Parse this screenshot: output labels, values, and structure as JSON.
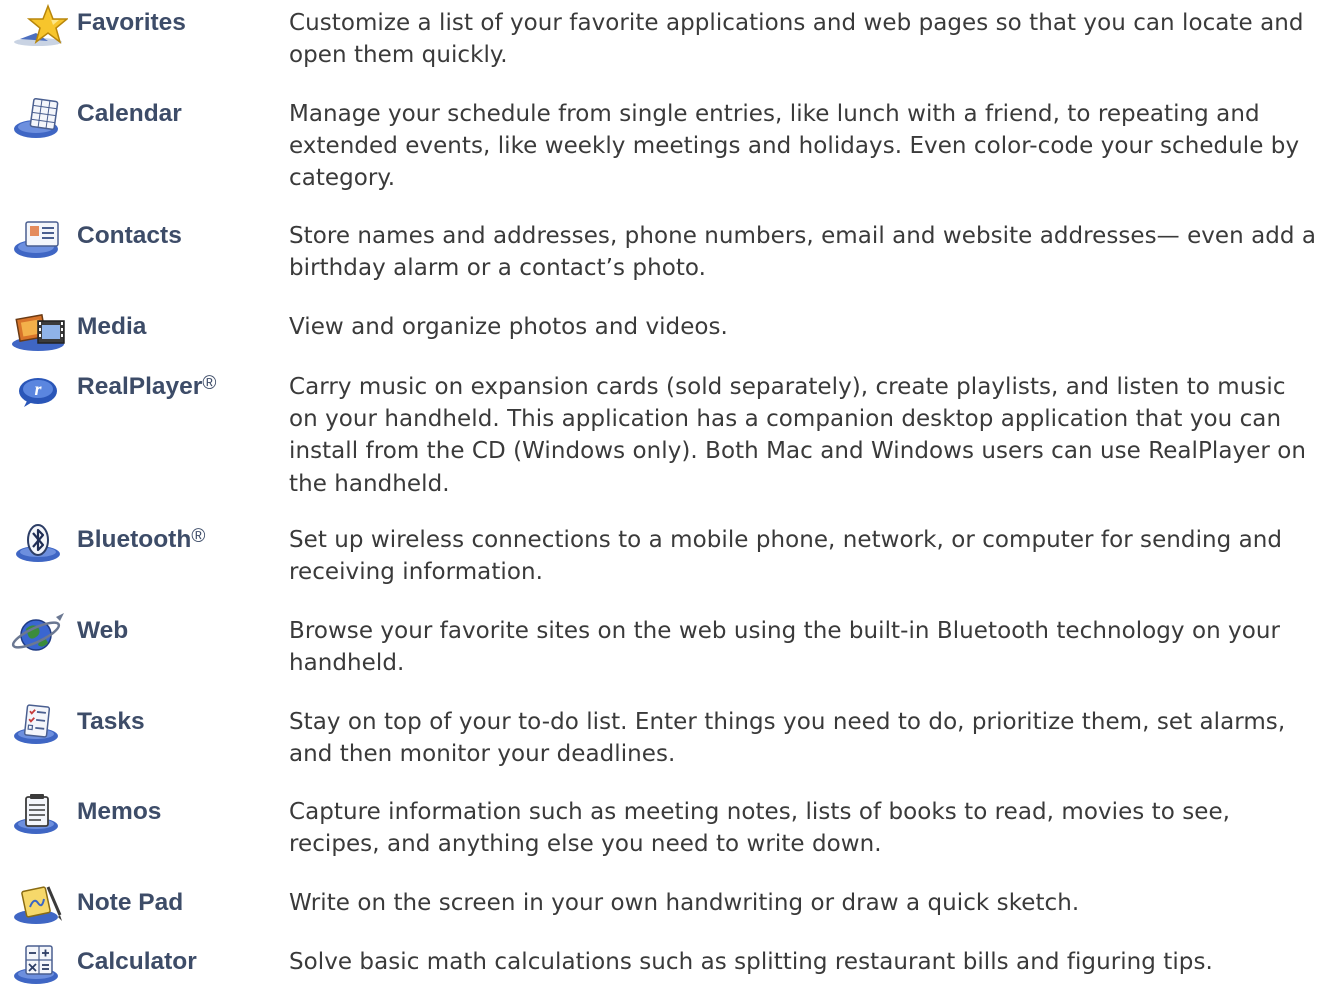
{
  "apps": [
    {
      "icon": "star-icon",
      "name": "Favorites",
      "reg": "",
      "desc": "Customize a list of your favorite applications and web pages so that you can locate and open them quickly."
    },
    {
      "icon": "calendar-icon",
      "name": "Calendar",
      "reg": "",
      "desc": "Manage your schedule from single entries, like lunch with a friend, to repeating and extended events, like weekly meetings and holidays. Even color-code your schedule by category."
    },
    {
      "icon": "contacts-icon",
      "name": "Contacts",
      "reg": "",
      "desc": "Store names and addresses, phone numbers, email and website addresses— even add a birthday alarm or a contact’s photo."
    },
    {
      "icon": "media-icon",
      "name": "Media",
      "reg": "",
      "desc": "View and organize photos and videos."
    },
    {
      "icon": "realplayer-icon",
      "name": "RealPlayer",
      "reg": "®",
      "desc": "Carry music on expansion cards (sold separately), create playlists, and listen to music on your handheld. This application has a companion desktop application that you can install from the CD (Windows only). Both Mac and Windows users can use RealPlayer on the handheld."
    },
    {
      "icon": "bluetooth-icon",
      "name": "Bluetooth",
      "reg": "®",
      "desc": "Set up wireless connections to a mobile phone, network, or computer for sending and receiving information."
    },
    {
      "icon": "web-globe-icon",
      "name": "Web",
      "reg": "",
      "desc": "Browse your favorite sites on the web using the built-in Bluetooth technology on your handheld."
    },
    {
      "icon": "tasks-checklist-icon",
      "name": "Tasks",
      "reg": "",
      "desc": "Stay on top of your to-do list. Enter things you need to do, prioritize them, set alarms, and then monitor your deadlines."
    },
    {
      "icon": "memos-notepad-icon",
      "name": "Memos",
      "reg": "",
      "desc": "Capture information such as meeting notes, lists of books to read, movies to see, recipes, and anything else you need to write down."
    },
    {
      "icon": "note-pad-icon",
      "name": "Note Pad",
      "reg": "",
      "desc": "Write on the screen in your own handwriting or draw a quick sketch."
    },
    {
      "icon": "calculator-icon",
      "name": "Calculator",
      "reg": "",
      "desc": "Solve basic math calculations such as splitting restaurant bills and figuring tips."
    }
  ]
}
